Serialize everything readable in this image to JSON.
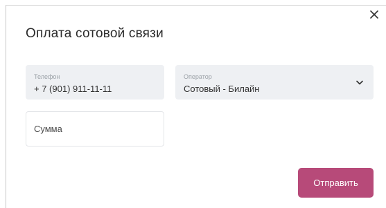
{
  "dialog": {
    "title": "Оплата сотовой связи",
    "close_icon": "close-icon"
  },
  "form": {
    "phone": {
      "label": "Телефон",
      "value": "+ 7 (901) 911-11-11"
    },
    "operator": {
      "label": "Оператор",
      "value": "Сотовый - Билайн",
      "icon": "chevron-down-icon"
    },
    "amount": {
      "placeholder": "Сумма",
      "value": ""
    },
    "submit_label": "Отправить"
  },
  "colors": {
    "accent": "#b74a79",
    "field_bg": "#eef0f3",
    "text": "#2b2b2b",
    "label": "#9aa0a6"
  }
}
